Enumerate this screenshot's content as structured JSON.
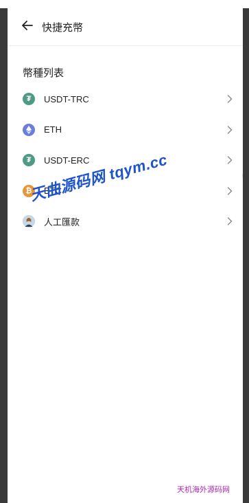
{
  "header": {
    "back_icon": "arrow-left-icon",
    "title": "快捷充幣"
  },
  "section": {
    "title": "幣種列表"
  },
  "coins": [
    {
      "label": "USDT-TRC",
      "icon": "tether-icon",
      "color": "#4e9a84",
      "glyph": "₮"
    },
    {
      "label": "ETH",
      "icon": "ethereum-icon",
      "color": "#6b7fd9",
      "glyph": "◆"
    },
    {
      "label": "USDT-ERC",
      "icon": "tether-icon",
      "color": "#4e9a84",
      "glyph": "₮"
    },
    {
      "label": "BTC",
      "icon": "bitcoin-icon",
      "color": "#e8963a",
      "glyph": "₿"
    },
    {
      "label": "人工匯款",
      "icon": "agent-avatar-icon",
      "color": "#c9d6e6",
      "glyph": "👤"
    }
  ],
  "overlays": {
    "watermark": "天曲源码网 tqym.cc",
    "footer_mark": "天机海外源码网"
  }
}
